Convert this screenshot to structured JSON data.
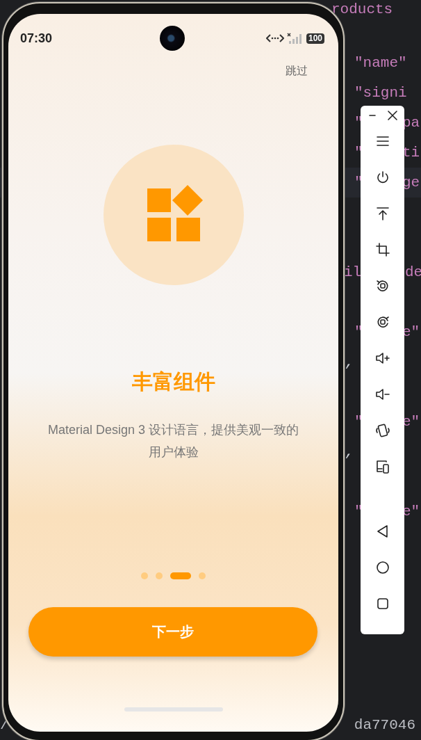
{
  "editor": {
    "lines": [
      {
        "kind": "top",
        "left": "roducts"
      },
      {
        "kind": "blank"
      },
      {
        "kind": "key",
        "left": "\"name\""
      },
      {
        "kind": "key",
        "left": "\"signi"
      },
      {
        "kind": "key",
        "left": "\"",
        "right": "pa"
      },
      {
        "kind": "key",
        "left": "\"",
        "right": "ti"
      },
      {
        "kind": "key",
        "left": "\"",
        "right": "ge",
        "highlighted": true
      },
      {
        "kind": "blank"
      },
      {
        "kind": "blank"
      },
      {
        "kind": "indent",
        "left": "il",
        "right": "de"
      },
      {
        "kind": "blank"
      },
      {
        "kind": "key",
        "left": "\"",
        "right": "e\""
      },
      {
        "kind": "comma",
        "left": ","
      },
      {
        "kind": "blank"
      },
      {
        "kind": "key",
        "left": "\"",
        "right": "e\""
      },
      {
        "kind": "comma",
        "left": ","
      },
      {
        "kind": "blank"
      },
      {
        "kind": "key",
        "left": "\"",
        "right": "e\""
      }
    ],
    "footer": {
      "left": "/",
      "right": "da77046"
    }
  },
  "phone": {
    "status_bar": {
      "time": "07:30",
      "battery": "100"
    },
    "skip": "跳过",
    "title": "丰富组件",
    "description": "Material Design 3 设计语言，提供美观一致的用户体验",
    "pages": [
      {
        "selected": false
      },
      {
        "selected": false
      },
      {
        "selected": true
      },
      {
        "selected": false
      }
    ],
    "next_button": "下一步"
  }
}
